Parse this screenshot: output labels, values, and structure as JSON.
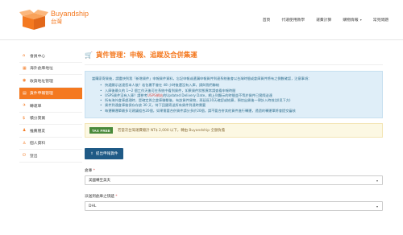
{
  "header": {
    "brand": "Buyandship",
    "region": "台灣",
    "nav": [
      {
        "label": "首頁",
        "caret": false
      },
      {
        "label": "代運使用教學",
        "caret": false
      },
      {
        "label": "運費計算",
        "caret": false
      },
      {
        "label": "購物情報",
        "caret": true
      },
      {
        "label": "常見問題",
        "caret": false
      }
    ]
  },
  "sidebar": {
    "items": [
      {
        "label": "會員中心",
        "icon": "home-icon",
        "glyph": "⌂"
      },
      {
        "label": "海外倉庫地址",
        "icon": "building-icon",
        "glyph": "▦"
      },
      {
        "label": "收貨地址管理",
        "icon": "map-marker-icon",
        "glyph": "◉"
      },
      {
        "label": "貨件申報管理",
        "icon": "cart-icon",
        "glyph": "▤",
        "active": true
      },
      {
        "label": "轉運單",
        "icon": "plane-icon",
        "glyph": "✈"
      },
      {
        "label": "積分獎賞",
        "icon": "gift-icon",
        "glyph": "$"
      },
      {
        "label": "推薦朋友",
        "icon": "users-icon",
        "glyph": "♟"
      },
      {
        "label": "個人資料",
        "icon": "user-icon",
        "glyph": "♙"
      },
      {
        "label": "登出",
        "icon": "power-icon",
        "glyph": "⏻"
      }
    ]
  },
  "main": {
    "title": "貨件管理：申報、追蹤及合併集運",
    "info": {
      "intro": "當購家寄貨後，請盡快到我「新增貨件」申報貨件資料，忘記申報或遺漏申報貨件到達系統後會以台灣時間或倉庫貨件將有之倒數確認，注意事項：",
      "bullets": [
        {
          "text": "快遞顯示送達您本人後？若包裹不會在 48 小時後還沒有入庫，請與我們聯絡",
          "red": ""
        },
        {
          "text": "入庫後最久約 1~2 個工作天後可在系統中看到貨件，如果貨件狀態異常請查看申報時間",
          "red": ""
        },
        {
          "text": "USPS貨件沒有入庫？請參考",
          "red": "USPS網站",
          "after": "的Updated Delivery Date，網上列顯示的時間並不等於貨件已實際送達"
        },
        {
          "text": "所有海外倉庫處理時，是確定與之倉庫聯繫後，有該貨件貨物，再延長10天確認或結算，預估出貨後一律計入時效(詳見下方)",
          "red": ""
        },
        {
          "text": "貨件到達倉庫後保存存放 30 天，待下回國寄送所有貨件到達時需要",
          "red": ""
        },
        {
          "text": "每運轉運單最多可建議組合20個，如果需要合併貨件請分多於20個，請不要合併其他貨件進行轉運，透過的轉運單將會提交審核",
          "red": ""
        }
      ]
    },
    "promo": {
      "badge": "TAX FREE",
      "text": "若當次台灣運費總計 NT$ 2,000 以下，轉由 Buyandship 全額負擔"
    },
    "button": {
      "label": "提出申報貨件",
      "icon": "upload-icon"
    },
    "fields": [
      {
        "label": "倉庫",
        "required": true,
        "value": "美國轉至美夫"
      },
      {
        "label": "派送到倉庫之快遞",
        "required": true,
        "value": "DHL"
      }
    ]
  },
  "colors": {
    "accent": "#f47920",
    "info_bg": "#dfeef8",
    "button": "#1f5a86",
    "promo_bg": "#fcf8e3",
    "badge": "#4a8a3a"
  }
}
